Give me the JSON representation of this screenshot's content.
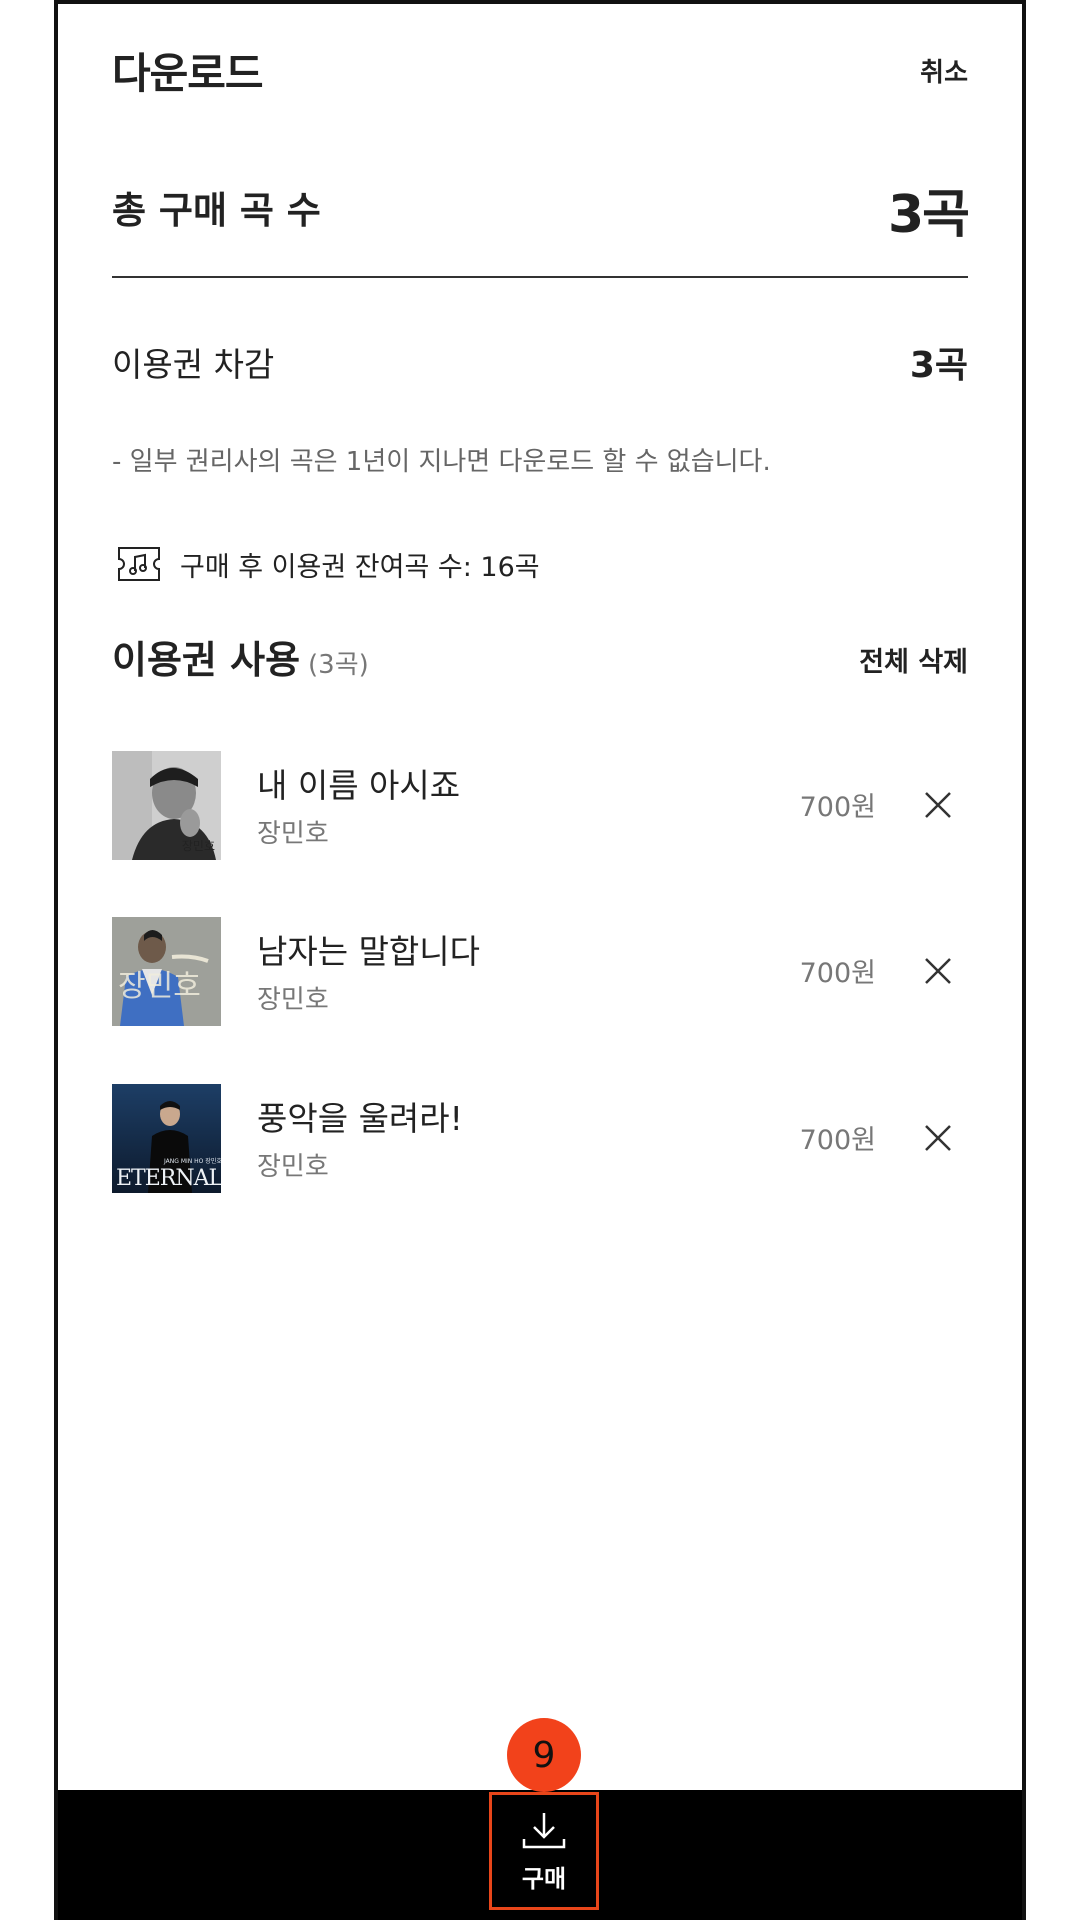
{
  "header": {
    "title": "다운로드",
    "cancel_label": "취소"
  },
  "summary": {
    "total_label": "총 구매 곡 수",
    "total_value": "3곡",
    "deduct_label": "이용권 차감",
    "deduct_value": "3곡",
    "notice": "- 일부 권리사의 곡은 1년이 지나면 다운로드 할 수 없습니다.",
    "remaining_text": "구매 후 이용권 잔여곡 수: 16곡",
    "remaining_icon": "music-note-ticket-icon"
  },
  "section": {
    "title": "이용권 사용",
    "count": "(3곡)",
    "delete_all_label": "전체 삭제"
  },
  "songs": [
    {
      "title": "내 이름 아시죠",
      "artist": "장민호",
      "price": "700원"
    },
    {
      "title": "남자는 말합니다",
      "artist": "장민호",
      "price": "700원"
    },
    {
      "title": "풍악을 울려라!",
      "artist": "장민호",
      "price": "700원"
    }
  ],
  "covers": [
    {
      "caption": "장민호"
    },
    {
      "caption": "장민호"
    },
    {
      "caption": "ETERNAL",
      "subcaption": "JANG MIN HO 장민호"
    }
  ],
  "bottom": {
    "buy_label": "구매",
    "badge_number": "9",
    "icon": "download-icon"
  },
  "colors": {
    "accent": "#f2421b",
    "bar": "#000000",
    "muted": "#777777"
  }
}
